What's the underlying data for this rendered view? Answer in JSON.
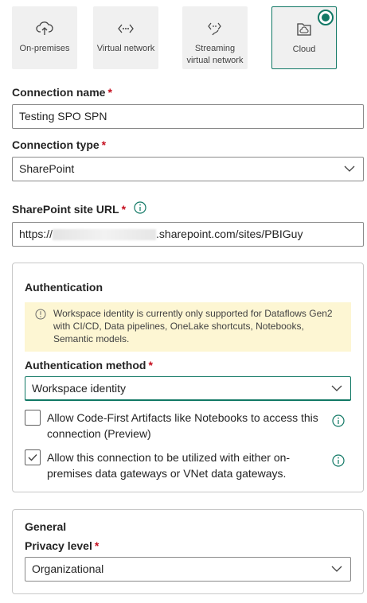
{
  "gateway_types": [
    {
      "label": "On-premises",
      "icon": "cloud-upload-icon"
    },
    {
      "label": "Virtual network",
      "icon": "virtual-network-icon"
    },
    {
      "label": "Streaming virtual network",
      "icon": "streaming-network-icon"
    },
    {
      "label": "Cloud",
      "icon": "cloud-document-icon",
      "selected": true
    }
  ],
  "connection_name": {
    "label": "Connection name",
    "required": "*",
    "value": "Testing SPO SPN"
  },
  "connection_type": {
    "label": "Connection type",
    "required": "*",
    "value": "SharePoint"
  },
  "site_url": {
    "label": "SharePoint site URL",
    "required": "*",
    "value_prefix": "https://",
    "value_suffix": ".sharepoint.com/sites/PBIGuy"
  },
  "authentication": {
    "title": "Authentication",
    "warning": "Workspace identity is currently only supported for Dataflows Gen2 with CI/CD, Data pipelines, OneLake shortcuts, Notebooks, Semantic models.",
    "method_label": "Authentication method",
    "method_required": "*",
    "method_value": "Workspace identity",
    "options": [
      {
        "label": "Allow Code-First Artifacts like Notebooks to access this connection (Preview)",
        "checked": false
      },
      {
        "label": "Allow this connection to be utilized with either on-premises data gateways or VNet data gateways.",
        "checked": true
      }
    ]
  },
  "general": {
    "title": "General",
    "privacy_label": "Privacy level",
    "privacy_required": "*",
    "privacy_value": "Organizational"
  },
  "colors": {
    "accent": "#117865",
    "required": "#c50f1f",
    "warning_bg": "#fdf6d3"
  }
}
